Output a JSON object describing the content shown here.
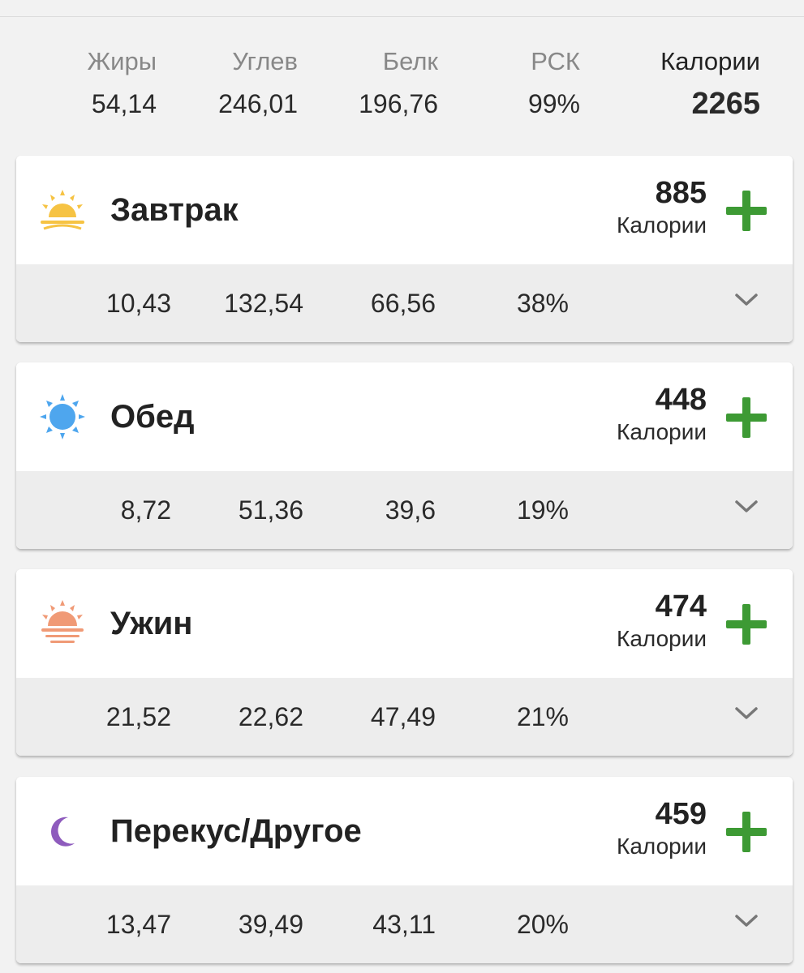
{
  "summary": {
    "fat": {
      "label": "Жиры",
      "value": "54,14"
    },
    "carbs": {
      "label": "Углев",
      "value": "246,01"
    },
    "protein": {
      "label": "Белк",
      "value": "196,76"
    },
    "rsk": {
      "label": "РСК",
      "value": "99%"
    },
    "calories": {
      "label": "Калории",
      "value": "2265"
    }
  },
  "colors": {
    "accent_green": "#3d9a34",
    "breakfast_icon": "#f6c343",
    "lunch_icon": "#4ea6ee",
    "dinner_icon": "#f09a76",
    "snack_icon": "#8e5bbd"
  },
  "meals": [
    {
      "name": "Завтрак",
      "icon": "sunrise-icon",
      "calories": "885",
      "calories_label": "Калории",
      "fat": "10,43",
      "carbs": "132,54",
      "protein": "66,56",
      "rsk": "38%"
    },
    {
      "name": "Обед",
      "icon": "sun-icon",
      "calories": "448",
      "calories_label": "Калории",
      "fat": "8,72",
      "carbs": "51,36",
      "protein": "39,6",
      "rsk": "19%"
    },
    {
      "name": "Ужин",
      "icon": "sunset-icon",
      "calories": "474",
      "calories_label": "Калории",
      "fat": "21,52",
      "carbs": "22,62",
      "protein": "47,49",
      "rsk": "21%"
    },
    {
      "name": "Перекус/Другое",
      "icon": "moon-icon",
      "calories": "459",
      "calories_label": "Калории",
      "fat": "13,47",
      "carbs": "39,49",
      "protein": "43,11",
      "rsk": "20%"
    }
  ]
}
